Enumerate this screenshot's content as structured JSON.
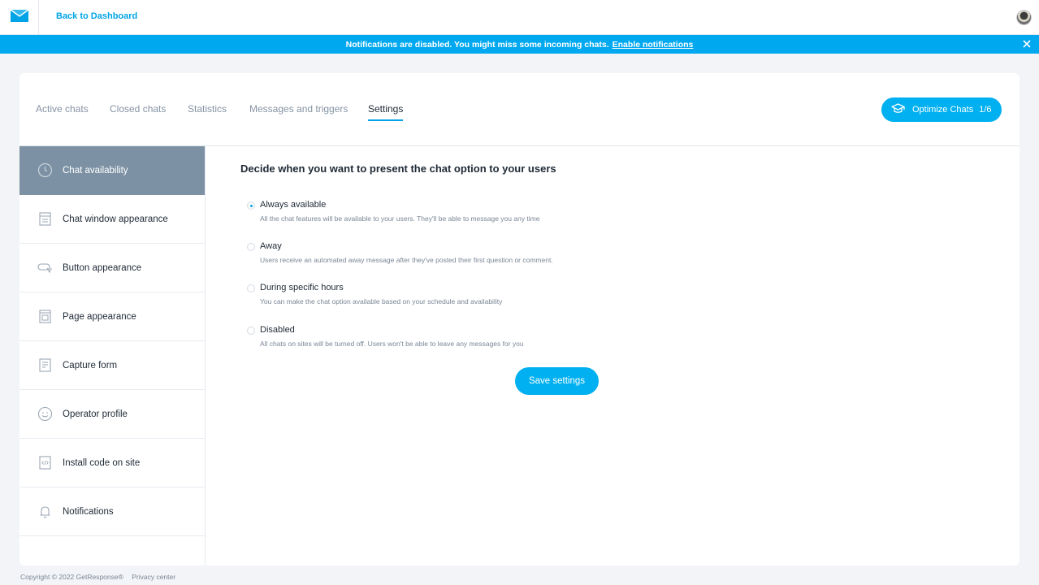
{
  "header": {
    "back_label": "Back to Dashboard",
    "logo_icon": "envelope-icon",
    "avatar_icon": "user-avatar"
  },
  "banner": {
    "message": "Notifications are disabled. You might miss some incoming chats.",
    "link_label": "Enable notifications",
    "close_icon": "close-icon"
  },
  "tabs": [
    {
      "label": "Active chats",
      "active": false
    },
    {
      "label": "Closed chats",
      "active": false
    },
    {
      "label": "Statistics",
      "active": false
    },
    {
      "label": "Messages and triggers",
      "active": false
    },
    {
      "label": "Settings",
      "active": true
    }
  ],
  "optimize": {
    "label": "Optimize Chats",
    "count": "1/6",
    "icon": "graduation-cap-icon"
  },
  "sidebar": {
    "items": [
      {
        "label": "Chat availability",
        "icon": "clock-icon",
        "active": true
      },
      {
        "label": "Chat window appearance",
        "icon": "window-icon",
        "active": false
      },
      {
        "label": "Button appearance",
        "icon": "chat-bubble-icon",
        "active": false
      },
      {
        "label": "Page appearance",
        "icon": "page-icon",
        "active": false
      },
      {
        "label": "Capture form",
        "icon": "form-icon",
        "active": false
      },
      {
        "label": "Operator profile",
        "icon": "smiley-icon",
        "active": false
      },
      {
        "label": "Install code on site",
        "icon": "code-icon",
        "active": false
      },
      {
        "label": "Notifications",
        "icon": "bell-icon",
        "active": false
      }
    ]
  },
  "content": {
    "heading": "Decide when you want to present the chat option to your users",
    "options": [
      {
        "title": "Always available",
        "desc": "All the chat features will be available to your users. They'll be able to message you any time",
        "checked": true
      },
      {
        "title": "Away",
        "desc": "Users receive an automated away message after they've posted their first question or comment.",
        "checked": false
      },
      {
        "title": "During specific hours",
        "desc": "You can make the chat option available based on your schedule and availability",
        "checked": false
      },
      {
        "title": "Disabled",
        "desc": "All chats on sites will be turned off. Users won't be able to leave any messages for you",
        "checked": false
      }
    ],
    "save_label": "Save settings"
  },
  "footer": {
    "copyright": "Copyright © 2022 GetResponse®",
    "privacy": "Privacy center"
  },
  "colors": {
    "accent": "#00a4e6",
    "banner": "#00a8f0",
    "sidebar_active": "#7c92a4"
  }
}
